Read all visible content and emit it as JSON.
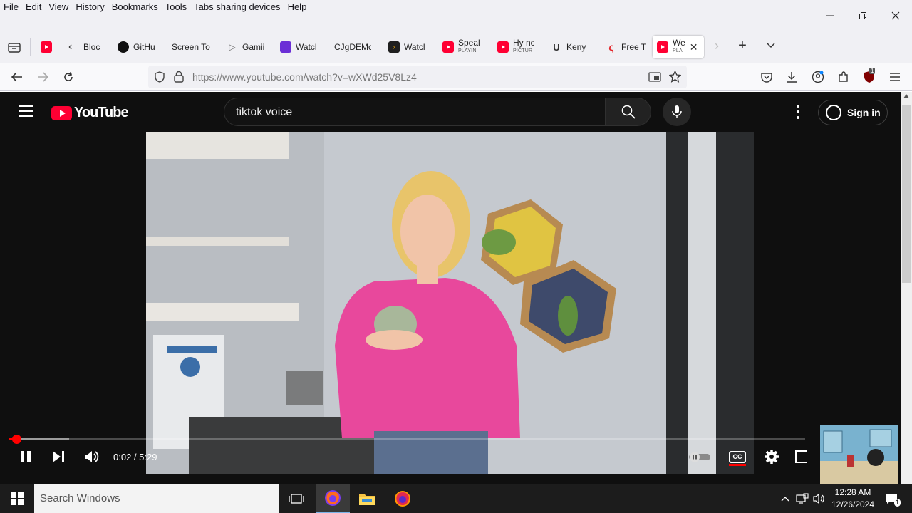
{
  "menu": [
    "File",
    "Edit",
    "View",
    "History",
    "Bookmarks",
    "Tools",
    "Tabs sharing devices",
    "Help"
  ],
  "tabs": [
    {
      "title": "Bloc"
    },
    {
      "title": "GitHu"
    },
    {
      "title": "Screen To"
    },
    {
      "title": "Gamii"
    },
    {
      "title": "Watcl"
    },
    {
      "title": "CJgDEMc"
    },
    {
      "title": "Watcl"
    },
    {
      "title": "Speal",
      "sub": "PLAYIN"
    },
    {
      "title": "Hy nc",
      "sub": "PICTUR"
    },
    {
      "title": "Keny"
    },
    {
      "title": "Free T"
    },
    {
      "title": "We",
      "sub": "PLA"
    }
  ],
  "address": {
    "url": "https://www.youtube.com/watch?v=wXWd25V8Lz4"
  },
  "extensions_badge": "1",
  "youtube": {
    "logo_text": "YouTube",
    "search_query": "tiktok voice",
    "sign_in_label": "Sign in"
  },
  "player": {
    "current_time": "0:02",
    "duration": "5:29",
    "time_display": "0:02 / 5:29",
    "played_fraction": 0.006,
    "buffered_fraction": 0.076,
    "cc_label": "CC"
  },
  "taskbar": {
    "search_placeholder": "Search Windows",
    "time": "12:28 AM",
    "date": "12/26/2024",
    "notifications_count": "1"
  },
  "colors": {
    "youtube_red": "#ff0033",
    "progress_red": "#ff0000",
    "dark_bg": "#0f0f0f"
  }
}
